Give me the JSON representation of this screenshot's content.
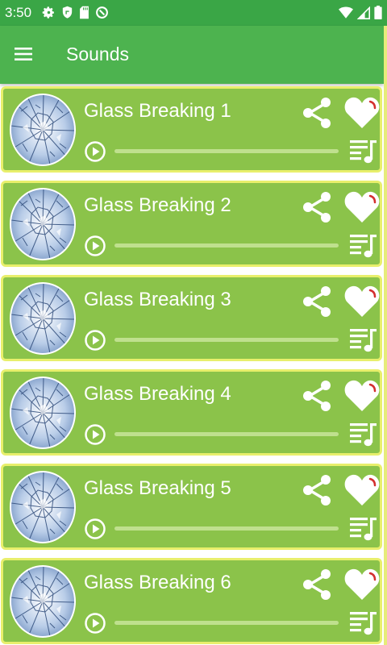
{
  "status_bar": {
    "time": "3:50",
    "left_icons": [
      "gear-icon",
      "shield-icon",
      "sd-card-icon",
      "data-saver-icon"
    ],
    "right_icons": [
      "wifi-icon",
      "signal-icon",
      "battery-icon"
    ]
  },
  "app_bar": {
    "menu_icon": "hamburger-menu-icon",
    "title": "Sounds"
  },
  "colors": {
    "status_bar": "#3aa646",
    "app_bar": "#4db34f",
    "card": "#8bc34a",
    "card_border": "#e8ef6c",
    "heart_accent": "#d32f2f"
  },
  "sounds": [
    {
      "title": "Glass Breaking 1",
      "progress": 0
    },
    {
      "title": "Glass Breaking 2",
      "progress": 0
    },
    {
      "title": "Glass Breaking 3",
      "progress": 0
    },
    {
      "title": "Glass Breaking 4",
      "progress": 0
    },
    {
      "title": "Glass Breaking 5",
      "progress": 0
    },
    {
      "title": "Glass Breaking 6",
      "progress": 0
    }
  ]
}
